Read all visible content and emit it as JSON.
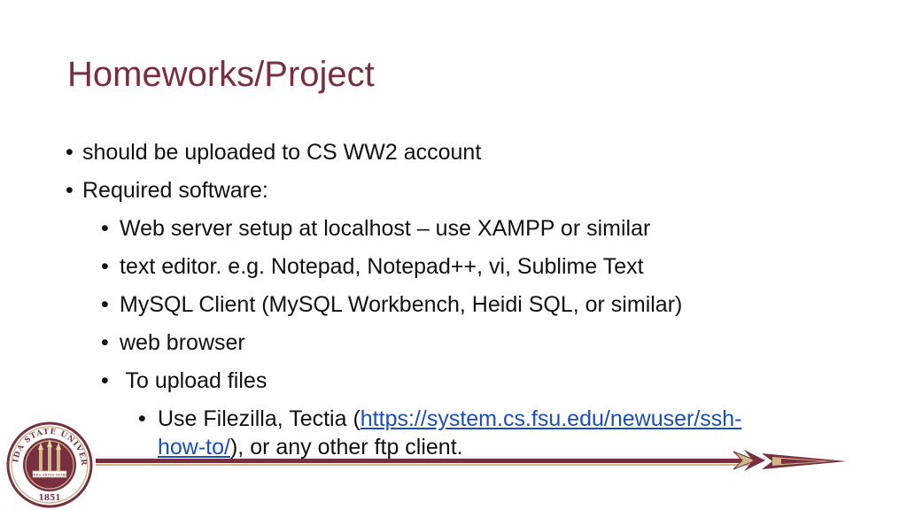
{
  "slide": {
    "title": "Homeworks/Project",
    "bullets": [
      {
        "text": "should be uploaded to CS WW2 account"
      },
      {
        "text": "Required software:"
      }
    ],
    "sub_bullets": [
      {
        "text": "Web server setup at localhost – use XAMPP or similar"
      },
      {
        "text": "text editor. e.g. Notepad, Notepad++, vi, Sublime Text"
      },
      {
        "text": "MySQL Client (MySQL Workbench, Heidi SQL, or similar)"
      },
      {
        "text": "web browser"
      },
      {
        "text": " To upload files"
      }
    ],
    "sub_sub_bullet": {
      "prefix": "Use Filezilla, Tectia (",
      "link_part1": "https://system.cs.fsu.edu/newuser/ssh-",
      "link_part2": "how-to/",
      "suffix": "), or any other ftp client."
    }
  },
  "branding": {
    "seal_top_text": "FLORIDA STATE UNIVERSITY",
    "seal_year": "1851",
    "seal_motto": "VIRES ARTES MORES",
    "maroon": "#782f40",
    "gold": "#ceb888",
    "icons": [
      "fsu-seal-icon",
      "spear-icon"
    ]
  }
}
